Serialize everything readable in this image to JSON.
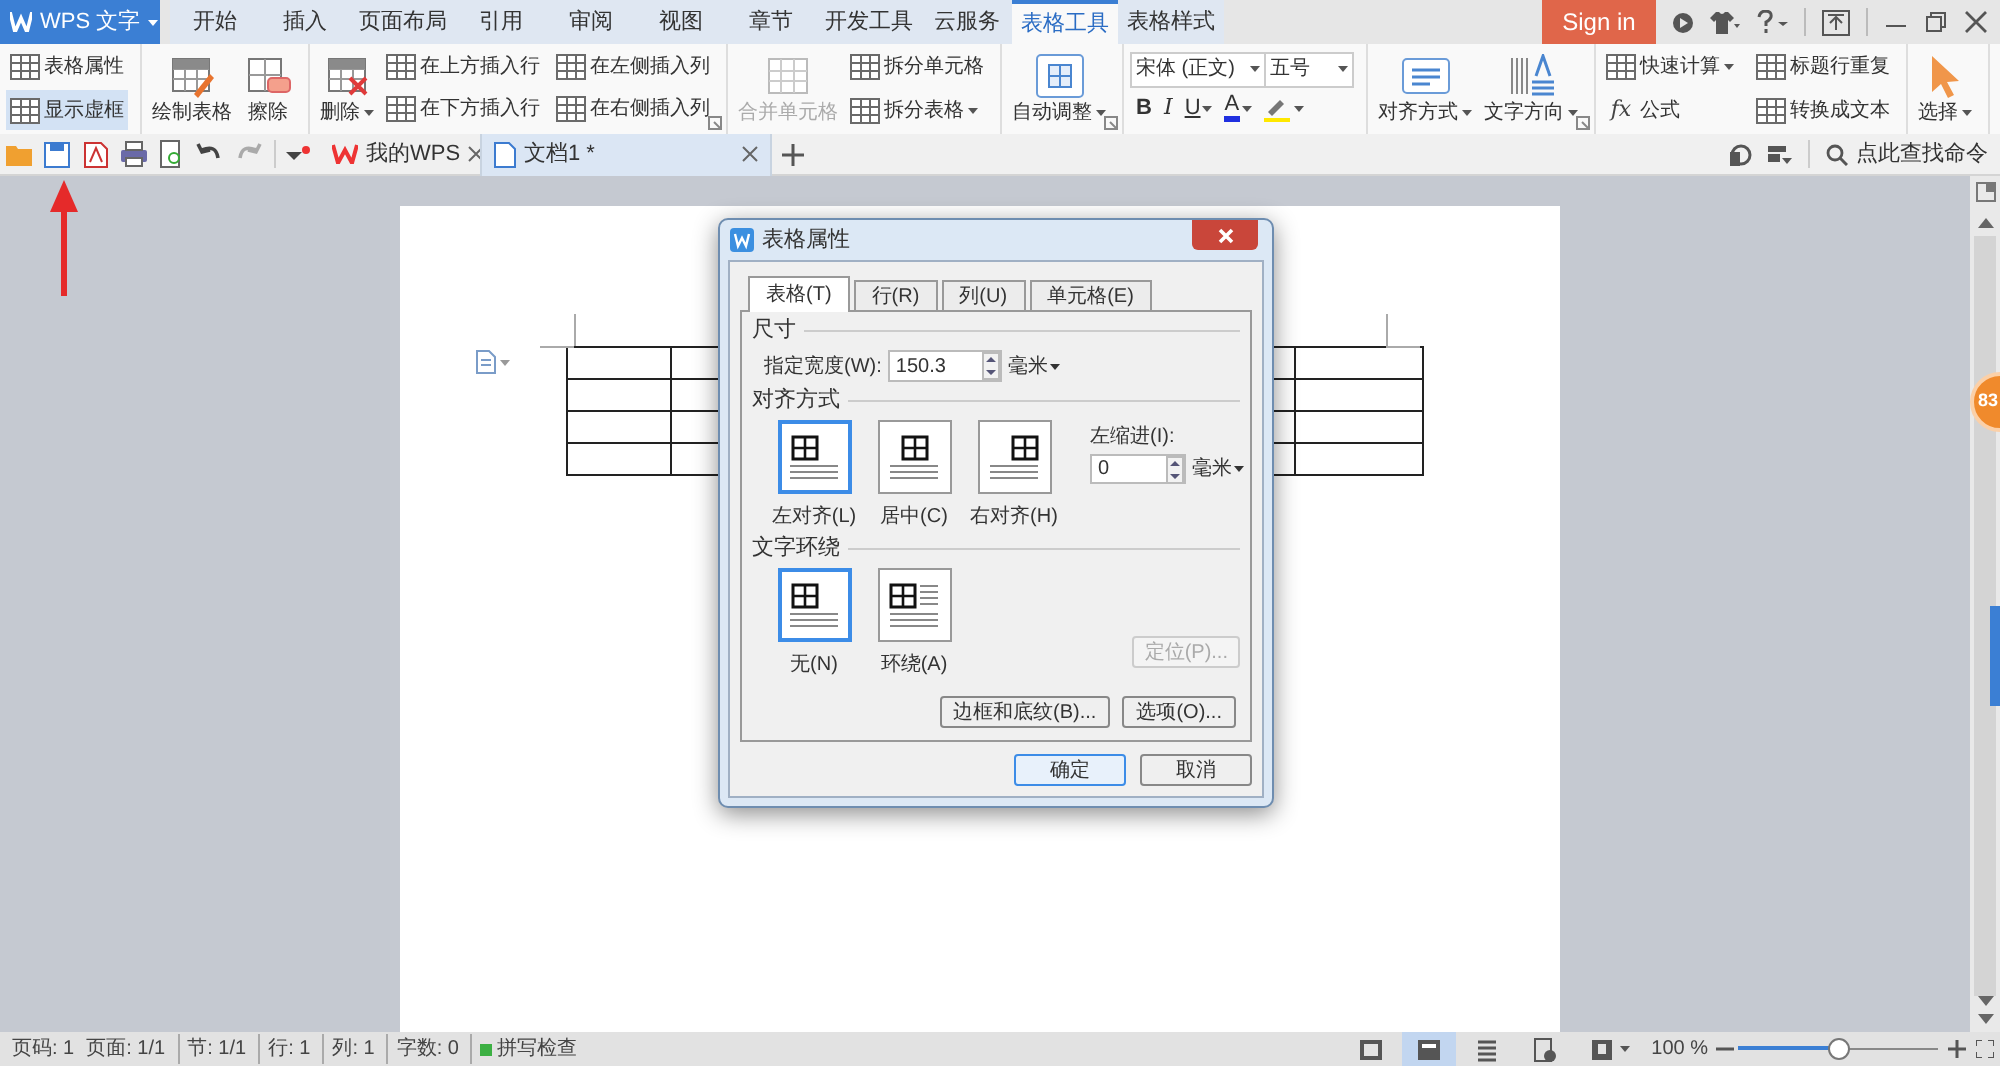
{
  "app_menu": {
    "label": "WPS 文字"
  },
  "menu_tabs": [
    {
      "label": "开始",
      "selected": false
    },
    {
      "label": "插入",
      "selected": false
    },
    {
      "label": "页面布局",
      "selected": false
    },
    {
      "label": "引用",
      "selected": false
    },
    {
      "label": "审阅",
      "selected": false
    },
    {
      "label": "视图",
      "selected": false
    },
    {
      "label": "章节",
      "selected": false
    },
    {
      "label": "开发工具",
      "selected": false
    },
    {
      "label": "云服务",
      "selected": false
    },
    {
      "label": "表格工具",
      "selected": true
    },
    {
      "label": "表格样式",
      "selected": false
    }
  ],
  "sign_in": "Sign in",
  "ribbon": {
    "groups": [
      {
        "kind": "buttons",
        "launcher": false,
        "items": [
          {
            "label": "表格属性",
            "kind": "small",
            "dropdown": false,
            "disabled": false,
            "on": false
          },
          {
            "label": "显示虚框",
            "kind": "small",
            "dropdown": false,
            "disabled": false,
            "on": true
          }
        ]
      },
      {
        "kind": "buttons",
        "launcher": false,
        "items": [
          {
            "label": "绘制表格",
            "kind": "large",
            "dropdown": false,
            "disabled": false,
            "on": false
          },
          {
            "label": "擦除",
            "kind": "large",
            "dropdown": false,
            "disabled": false,
            "on": false
          }
        ]
      },
      {
        "kind": "buttons",
        "launcher": true,
        "items": [
          {
            "label": "删除",
            "kind": "large",
            "dropdown": true,
            "disabled": false,
            "on": false
          },
          {
            "label": "在上方插入行",
            "kind": "small",
            "dropdown": false,
            "disabled": false,
            "on": false
          },
          {
            "label": "在下方插入行",
            "kind": "small",
            "dropdown": false,
            "disabled": false,
            "on": false
          },
          {
            "label": "在左侧插入列",
            "kind": "small",
            "dropdown": false,
            "disabled": false,
            "on": false
          },
          {
            "label": "在右侧插入列",
            "kind": "small",
            "dropdown": false,
            "disabled": false,
            "on": false
          }
        ]
      },
      {
        "kind": "buttons",
        "launcher": false,
        "items": [
          {
            "label": "合并单元格",
            "kind": "large",
            "dropdown": false,
            "disabled": true,
            "on": false
          },
          {
            "label": "拆分单元格",
            "kind": "small",
            "dropdown": false,
            "disabled": false,
            "on": false
          },
          {
            "label": "拆分表格",
            "kind": "small",
            "dropdown": true,
            "disabled": false,
            "on": false
          }
        ]
      },
      {
        "kind": "buttons",
        "launcher": true,
        "items": [
          {
            "label": "自动调整",
            "kind": "large",
            "dropdown": true,
            "disabled": false,
            "on": false
          }
        ]
      },
      {
        "kind": "font",
        "launcher": false,
        "font_name": "宋体 (正文)",
        "font_size": "五号",
        "format_buttons": [
          {
            "label": "B",
            "dropdown": false
          },
          {
            "label": "I",
            "dropdown": false
          },
          {
            "label": "U",
            "dropdown": true
          },
          {
            "label": "A",
            "dropdown": true
          }
        ]
      },
      {
        "kind": "buttons",
        "launcher": true,
        "items": [
          {
            "label": "对齐方式",
            "kind": "large",
            "dropdown": true,
            "disabled": false,
            "on": false
          },
          {
            "label": "文字方向",
            "kind": "large",
            "dropdown": true,
            "disabled": false,
            "on": false
          }
        ]
      },
      {
        "kind": "buttons",
        "launcher": false,
        "items": [
          {
            "label": "快速计算",
            "kind": "small",
            "dropdown": true,
            "disabled": false,
            "on": false
          },
          {
            "label": "标题行重复",
            "kind": "small",
            "dropdown": false,
            "disabled": false,
            "on": false
          },
          {
            "label": "公式",
            "kind": "small",
            "dropdown": false,
            "disabled": false,
            "on": false,
            "glyph": "fx"
          },
          {
            "label": "转换成文本",
            "kind": "small",
            "dropdown": false,
            "disabled": false,
            "on": false
          }
        ]
      },
      {
        "kind": "buttons",
        "launcher": false,
        "items": [
          {
            "label": "选择",
            "kind": "large",
            "dropdown": true,
            "disabled": false,
            "on": false
          }
        ]
      }
    ]
  },
  "doc_tabs": [
    {
      "label": "我的WPS",
      "selected": false
    },
    {
      "label": "文档1 *",
      "selected": true
    }
  ],
  "command_search": "点此查找命令",
  "side_badge": "83",
  "dialog": {
    "title": "表格属性",
    "tabs": [
      {
        "label": "表格(T)",
        "selected": true
      },
      {
        "label": "行(R)",
        "selected": false
      },
      {
        "label": "列(U)",
        "selected": false
      },
      {
        "label": "单元格(E)",
        "selected": false
      }
    ],
    "size": {
      "heading": "尺寸",
      "width_label": "指定宽度(W):",
      "width_value": "150.3",
      "unit": "毫米"
    },
    "alignment": {
      "heading": "对齐方式",
      "options": [
        {
          "label": "左对齐(L)",
          "selected": true
        },
        {
          "label": "居中(C)",
          "selected": false
        },
        {
          "label": "右对齐(H)",
          "selected": false
        }
      ],
      "indent_label": "左缩进(I):",
      "indent_value": "0",
      "unit": "毫米"
    },
    "wrapping": {
      "heading": "文字环绕",
      "options": [
        {
          "label": "无(N)",
          "selected": true
        },
        {
          "label": "环绕(A)",
          "selected": false
        }
      ]
    },
    "position_button": {
      "label": "定位(P)...",
      "disabled": true
    },
    "buttons": [
      {
        "label": "边框和底纹(B)..."
      },
      {
        "label": "选项(O)..."
      }
    ],
    "footer_buttons": [
      {
        "label": "确定",
        "default": true
      },
      {
        "label": "取消",
        "default": false
      }
    ]
  },
  "status_bar": {
    "items": [
      "页码: 1",
      "页面: 1/1",
      "节: 1/1",
      "行: 1",
      "列: 1",
      "字数: 0",
      "拼写检查"
    ],
    "view_modes": [
      {
        "selected": false
      },
      {
        "selected": true
      },
      {
        "selected": false
      },
      {
        "selected": false
      },
      {
        "selected": false
      }
    ],
    "zoom": "100 %",
    "zoom_slider": {
      "level": 0.5
    }
  }
}
